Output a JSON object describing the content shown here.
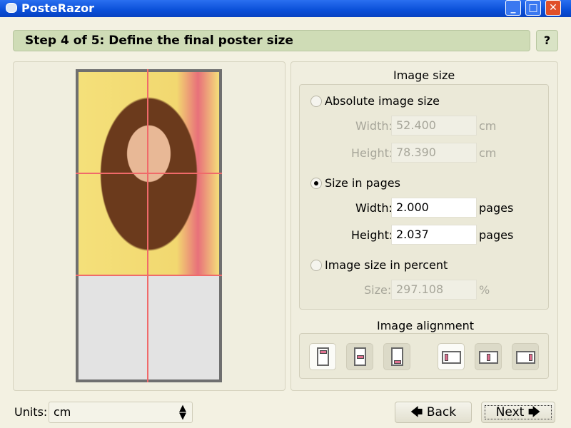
{
  "window": {
    "title": "PosteRazor"
  },
  "step": {
    "title": "Step 4 of 5: Define the final poster size",
    "help_label": "?"
  },
  "image_size": {
    "title": "Image size",
    "absolute": {
      "label": "Absolute image size",
      "selected": false,
      "width_label": "Width:",
      "width": "52.400",
      "width_unit": "cm",
      "height_label": "Height:",
      "height": "78.390",
      "height_unit": "cm"
    },
    "pages": {
      "label": "Size in pages",
      "selected": true,
      "width_label": "Width:",
      "width": "2.000",
      "width_unit": "pages",
      "height_label": "Height:",
      "height": "2.037",
      "height_unit": "pages"
    },
    "percent": {
      "label": "Image size in percent",
      "selected": false,
      "size_label": "Size:",
      "size": "297.108",
      "size_unit": "%"
    }
  },
  "alignment": {
    "title": "Image alignment",
    "vertical": [
      "top",
      "center",
      "bottom"
    ],
    "horizontal": [
      "left",
      "center",
      "right"
    ],
    "selected_vertical": "top",
    "selected_horizontal": "left"
  },
  "bottom": {
    "units_label": "Units:",
    "units_value": "cm",
    "back_label": "Back",
    "next_label": "Next"
  }
}
